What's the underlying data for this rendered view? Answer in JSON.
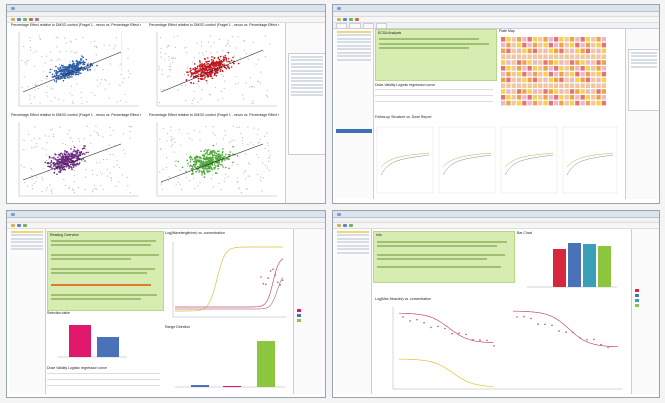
{
  "colors": {
    "scatter_blue": "#2f5fa7",
    "scatter_red": "#c2171d",
    "scatter_purple": "#6a2a80",
    "scatter_green": "#4ea83a",
    "note_green": "#d6ecb0",
    "bar_pink": "#e0176a",
    "bar_blue": "#4a72b8",
    "bar_red": "#d7263d",
    "bar_teal": "#3aa0b8",
    "bar_lime": "#8cc63e",
    "curve_pink": "#c0506e",
    "curve_yellow": "#d8c53a"
  },
  "window_tl": {
    "charts": [
      {
        "title": "Percentage Effect relative to DMSO control (Fragel 1 - neuro vs. Percentage Effect relative"
      },
      {
        "title": "Percentage Effect relative to DMSO control (Fragel 1 - neuro vs. Percentage Effect relative"
      },
      {
        "title": "Percentage Effect relative to DMSO control (Fragel 1 - neuro vs. Percentage Effect relative"
      },
      {
        "title": "Percentage Effect relative to DMSO control (Fragel 1 - neuro vs. Percentage Effect relative"
      }
    ]
  },
  "window_tr": {
    "plate_title": "Plate Map",
    "note_title": "ECSA Analysis",
    "fit_title": "Dose-Validity Logistic regression curve",
    "table_title": "Dose-Validity Logistic regression curve",
    "curves_title": "Follow-up Structure vs. Dose Report"
  },
  "window_bl": {
    "note_title": "Reading Overview",
    "selection_title": "Selection table",
    "curve_title": "Log(Wavelength/nm) vs. concentration",
    "bar2_title": "Range Direction",
    "table_title": "Dose Validity Logistic regression curve"
  },
  "window_br": {
    "note_title": "Info",
    "bar_title": "Bar Chart",
    "curve_title": "Log(Max Muscles) vs. concentration"
  }
}
